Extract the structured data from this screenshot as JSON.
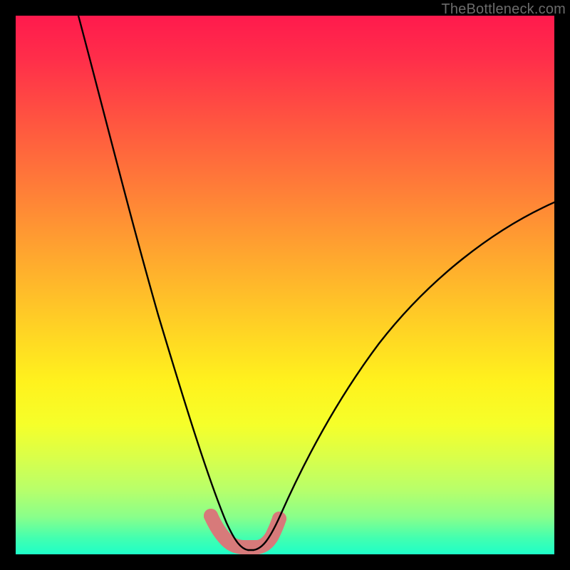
{
  "watermark": "TheBottleneck.com",
  "chart_data": {
    "type": "line",
    "title": "",
    "xlabel": "",
    "ylabel": "",
    "xlim": [
      0,
      100
    ],
    "ylim": [
      0,
      100
    ],
    "series": [
      {
        "name": "bottleneck-curve",
        "x": [
          0,
          5,
          10,
          15,
          20,
          25,
          30,
          34,
          37,
          39,
          41,
          45,
          47,
          50,
          55,
          60,
          65,
          70,
          75,
          80,
          85,
          90,
          95,
          100
        ],
        "y": [
          100,
          90,
          80,
          69,
          58,
          46,
          33,
          20,
          10,
          4,
          1,
          1,
          4,
          9,
          17,
          25,
          32,
          38,
          44,
          49,
          54,
          58,
          62,
          65
        ]
      },
      {
        "name": "highlight-band",
        "x": [
          37,
          39,
          41,
          43,
          45,
          47
        ],
        "y": [
          5,
          2,
          1,
          1,
          2,
          5
        ]
      }
    ],
    "colors": {
      "curve": "#000000",
      "highlight": "#d77a7a",
      "gradient_top": "#ff1a4d",
      "gradient_bottom": "#1effc8"
    }
  }
}
